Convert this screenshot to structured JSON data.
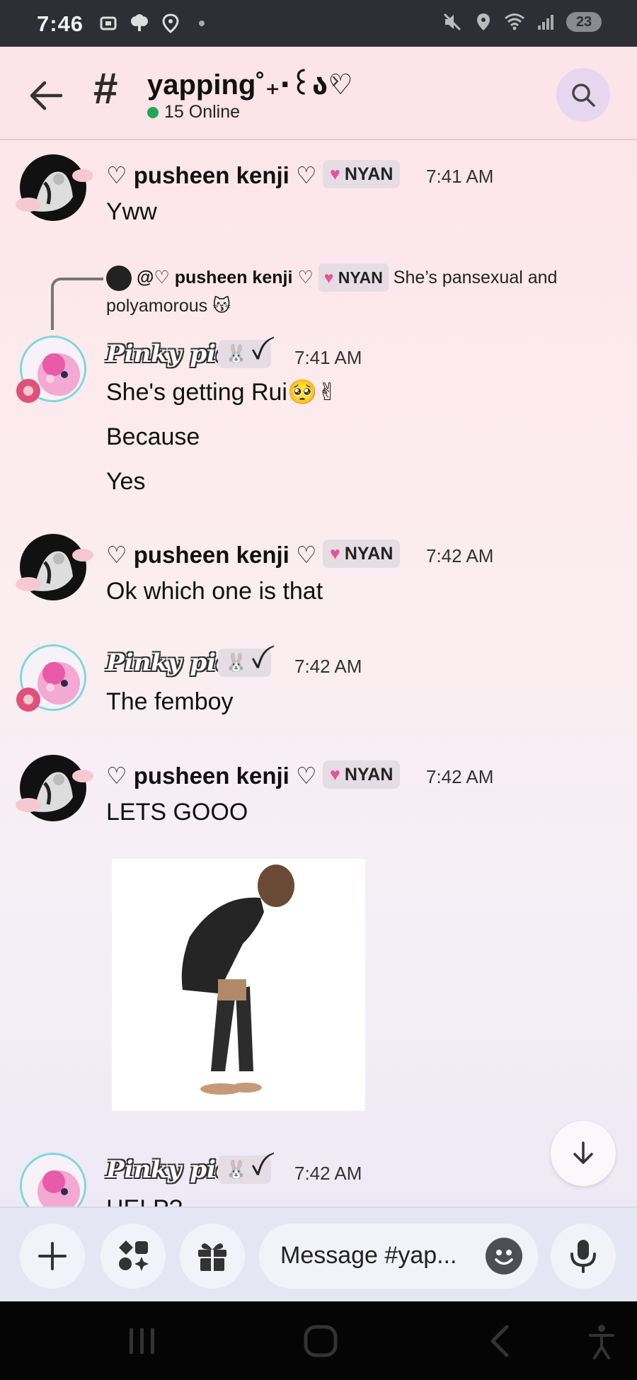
{
  "status_bar": {
    "time": "7:46",
    "battery": "23"
  },
  "header": {
    "channel_name": "yapping˚₊‧꒰ა♡",
    "online_text": "15 Online"
  },
  "messages": {
    "m1": {
      "author": "♡ pusheen kenji ♡",
      "tag": "NYAN",
      "time": "7:41 AM",
      "lines": [
        "Yww"
      ]
    },
    "reply": {
      "mention": "@♡ pusheen kenji ♡",
      "tag": "NYAN",
      "text": "She’s pansexual and polyamorous",
      "emoji": "😽"
    },
    "m2": {
      "author": "Pinky pie",
      "tag": "ꪜ",
      "time": "7:41 AM",
      "line1": "She's getting Rui",
      "line1_emoji": "🥺✌",
      "line2": "Because",
      "line3": "Yes"
    },
    "m3": {
      "author": "♡ pusheen kenji ♡",
      "tag": "NYAN",
      "time": "7:42 AM",
      "text": "Ok which one is that"
    },
    "m4": {
      "author": "Pinky pie",
      "tag": "ꪜ",
      "time": "7:42 AM",
      "text": "The femboy"
    },
    "m5": {
      "author": "♡ pusheen kenji ♡",
      "tag": "NYAN",
      "time": "7:42 AM",
      "text": "LETS GOOO"
    },
    "m6": {
      "author": "Pinky pie",
      "tag": "ꪜ",
      "time": "7:42 AM",
      "text": "HELP?"
    }
  },
  "composer": {
    "placeholder": "Message #yap..."
  },
  "icons": {
    "back": "arrow-left-icon",
    "search": "search-icon",
    "scroll": "arrow-down-icon",
    "add": "plus-icon",
    "apps": "apps-icon",
    "gift": "gift-icon",
    "emoji": "emoji-icon",
    "mic": "microphone-icon"
  },
  "colors": {
    "header_bg": "#fde4e8",
    "online": "#23a55a",
    "tag_bg": "#e5dde3"
  }
}
